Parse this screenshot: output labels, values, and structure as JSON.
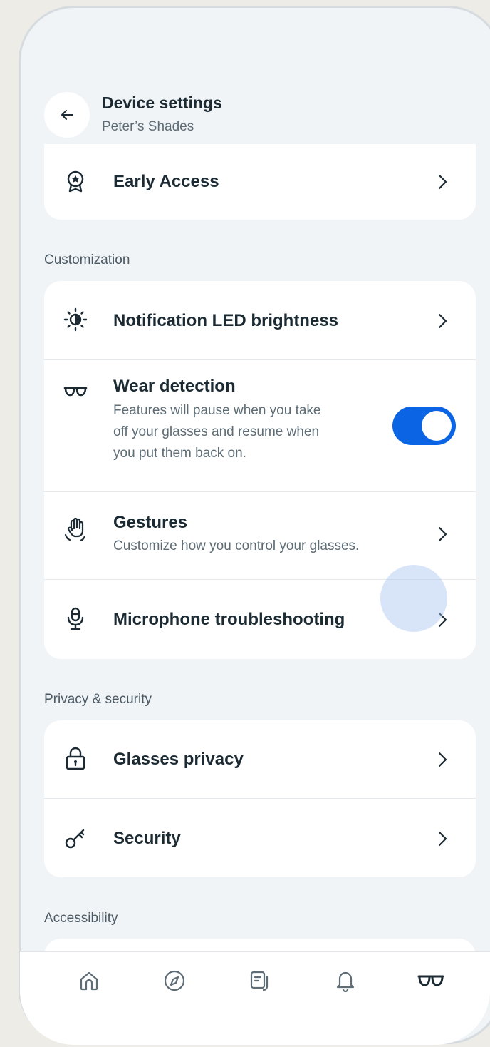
{
  "header": {
    "title": "Device settings",
    "subtitle": "Peter’s Shades"
  },
  "top_card": {
    "early_access": {
      "label": "Early Access",
      "icon": "award-badge-icon"
    }
  },
  "sections": {
    "customization": {
      "label": "Customization",
      "items": {
        "led": {
          "label": "Notification LED brightness",
          "icon": "brightness-icon"
        },
        "wear": {
          "label": "Wear detection",
          "description_lines": [
            "Features will pause when you take",
            "off your glasses and resume when",
            "you put them back on."
          ],
          "icon": "glasses-icon",
          "toggle_on": true
        },
        "gestures": {
          "label": "Gestures",
          "description": "Customize how you control your glasses.",
          "icon": "hand-gesture-icon"
        },
        "microphone": {
          "label": "Microphone troubleshooting",
          "icon": "microphone-icon"
        }
      }
    },
    "privacy": {
      "label": "Privacy & security",
      "items": {
        "glasses_privacy": {
          "label": "Glasses privacy",
          "icon": "lock-icon"
        },
        "security": {
          "label": "Security",
          "icon": "key-icon"
        }
      }
    },
    "accessibility": {
      "label": "Accessibility"
    }
  },
  "bottom_nav": {
    "items": [
      "home-icon",
      "compass-icon",
      "feed-icon",
      "bell-icon",
      "glasses-icon"
    ],
    "active": "glasses-icon"
  },
  "colors": {
    "accent": "#0a64e4",
    "background": "#f1f4f7",
    "card": "#ffffff",
    "text_primary": "#1c2b33",
    "text_secondary": "#5d6c75"
  }
}
